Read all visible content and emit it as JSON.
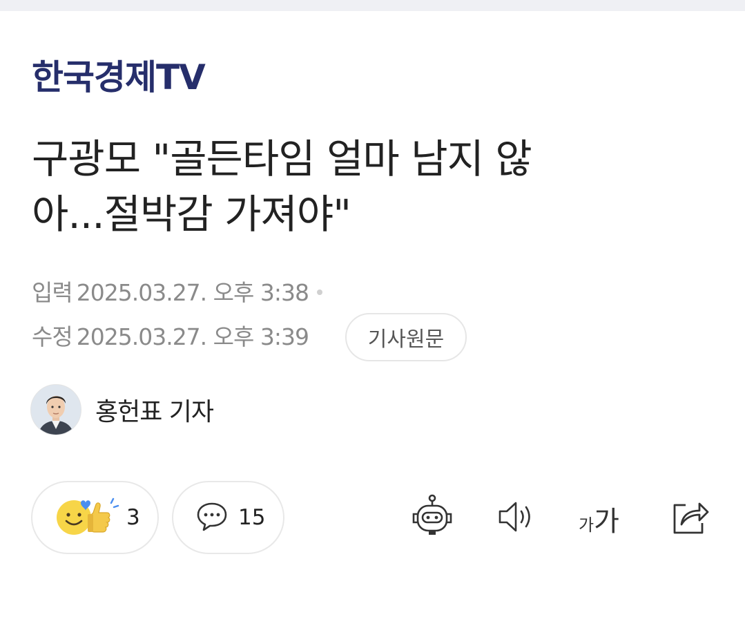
{
  "publisher": {
    "name": "한국경제TV"
  },
  "article": {
    "headline": "구광모 \"골든타임 얼마 남지 않\n아...절박감 가져야\"",
    "input_label": "입력",
    "input_time": "2025.03.27. 오후 3:38",
    "modified_label": "수정",
    "modified_time": "2025.03.27. 오후 3:39",
    "source_button_label": "기사원문"
  },
  "reporter": {
    "name": "홍헌표 기자"
  },
  "actions": {
    "reaction_count": "3",
    "comment_count": "15",
    "font_size_small": "가",
    "font_size_large": "가"
  },
  "icons": {
    "reaction": "smile-thumbs-up-icon",
    "comment": "speech-bubble-icon",
    "summary_bot": "robot-icon",
    "listen": "speaker-icon",
    "font_size": "font-size-icon",
    "share": "share-icon"
  },
  "colors": {
    "publisher": "#262e6b",
    "meta_text": "#8a8a8a",
    "heart": "#4a8ef0",
    "emoji": "#f7d548"
  }
}
